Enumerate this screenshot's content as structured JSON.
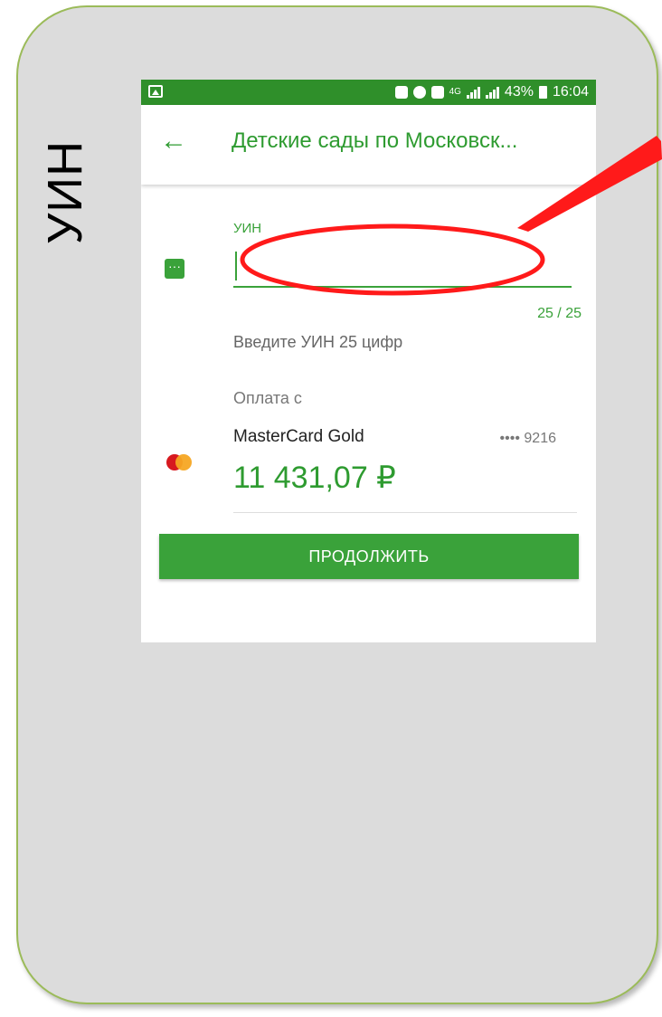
{
  "slide": {
    "side_label": "УИН"
  },
  "status_bar": {
    "network": "4G",
    "battery": "43%",
    "time": "16:04"
  },
  "app_bar": {
    "title": "Детские сады по Московск..."
  },
  "uin_field": {
    "label": "УИН",
    "value": "",
    "counter": "25 / 25",
    "hint": "Введите УИН 25 цифр"
  },
  "payment": {
    "label": "Оплата с",
    "card_name": "MasterCard Gold",
    "card_mask": "•••• 9216",
    "balance": "11 431,07 ₽"
  },
  "continue_button": {
    "label": "ПРОДОЛЖИТЬ"
  },
  "colors": {
    "status_bar": "#2f8f2a",
    "accent": "#3aa23a",
    "annotation": "#ff1a1a",
    "card_border": "#9bbb59"
  }
}
